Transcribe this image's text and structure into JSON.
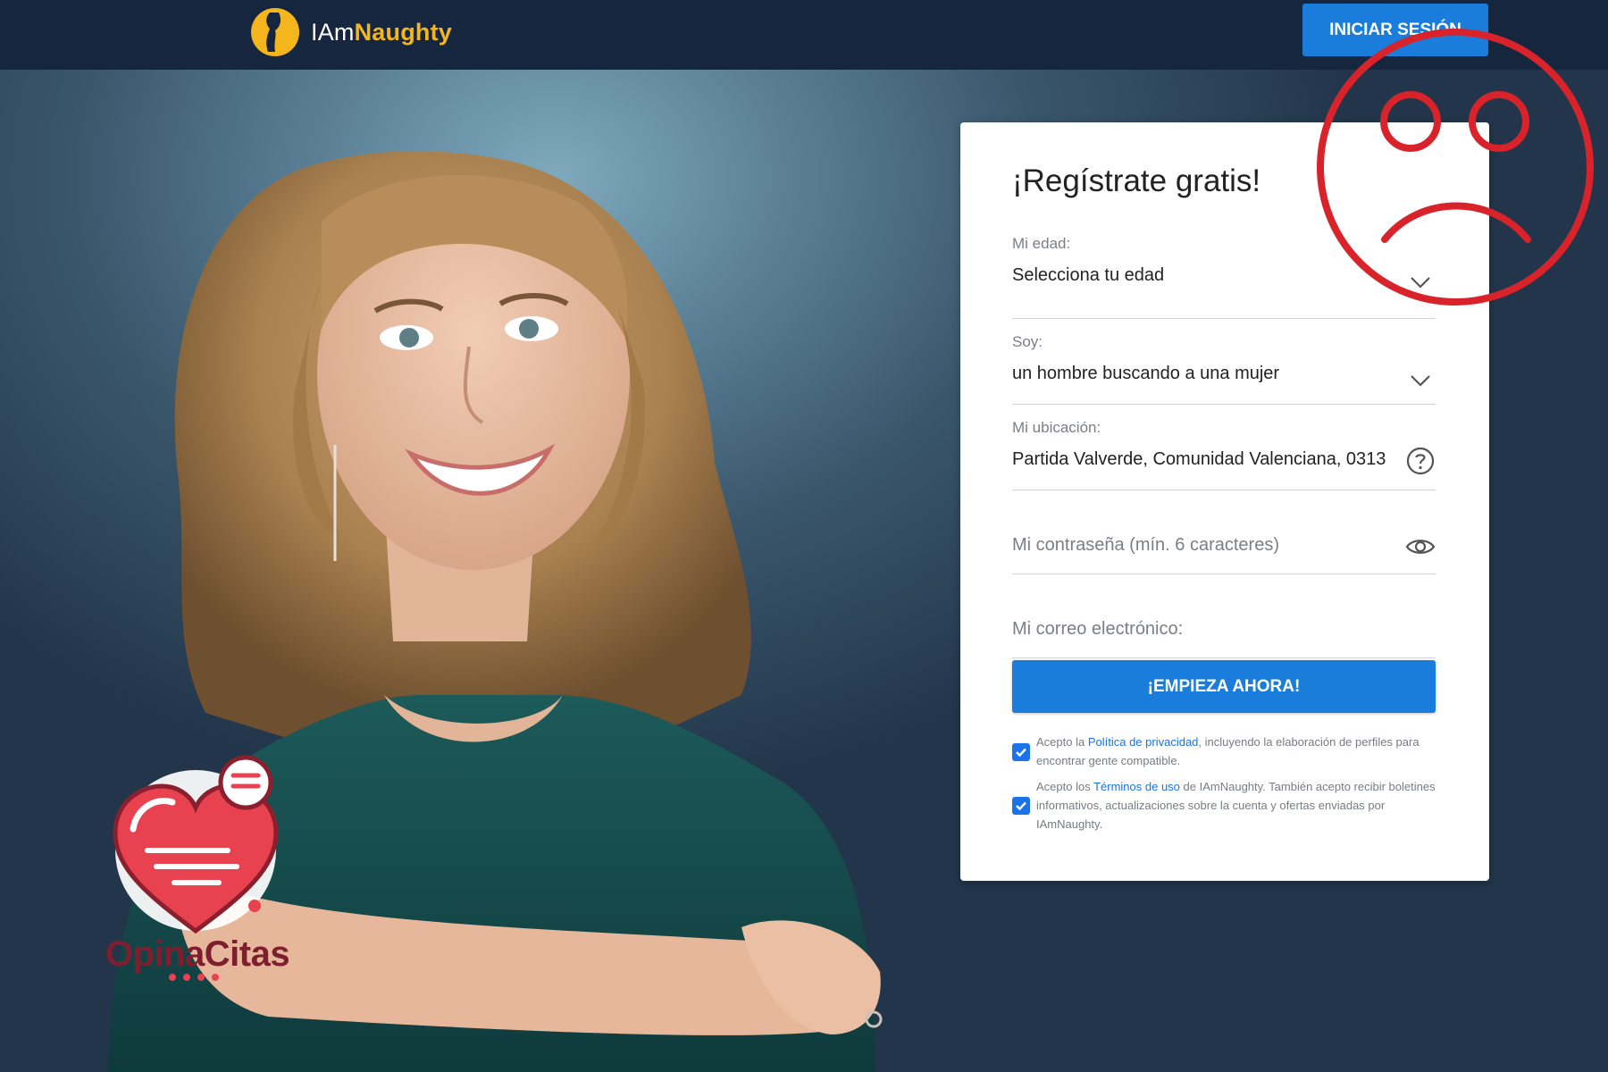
{
  "header": {
    "brand_prefix": "IAm",
    "brand_accent": "Naughty",
    "login_label": "INICIAR SESIÓN"
  },
  "form": {
    "title": "¡Regístrate gratis!",
    "age": {
      "label": "Mi edad:",
      "value": "Selecciona tu edad"
    },
    "soy": {
      "label": "Soy:",
      "value": "un hombre buscando a una mujer"
    },
    "location": {
      "label": "Mi ubicación:",
      "value": "Partida Valverde, Comunidad Valenciana, 0313"
    },
    "password": {
      "placeholder": "Mi contraseña (mín. 6 caracteres)"
    },
    "email": {
      "placeholder": "Mi correo electrónico:"
    },
    "submit_label": "¡EMPIEZA AHORA!",
    "consent_privacy": {
      "checked": true,
      "before": "Acepto la ",
      "link": "Política de privacidad",
      "after": ", incluyendo la elaboración de perfiles para encontrar gente compatible."
    },
    "consent_terms": {
      "checked": true,
      "before": "Acepto los ",
      "link": "Términos de uso",
      "after": " de IAmNaughty. También acepto recibir boletines informativos, actualizaciones sobre la cuenta y ofertas enviadas por IAmNaughty."
    }
  },
  "watermark": {
    "text": "OpinaCitas"
  },
  "colors": {
    "header_bg": "#16263f",
    "accent_blue": "#1a7ddb",
    "brand_yellow": "#f4b61c",
    "sad_face_red": "#d9232b",
    "watermark_red": "#7d1f2f"
  },
  "icons": {
    "age_select": "chevron-down-icon",
    "soy_select": "chevron-down-icon",
    "location_help": "question-circle-icon",
    "password_toggle": "eye-icon",
    "overlay": "sad-face-icon",
    "watermark": "heart-chat-icon"
  }
}
